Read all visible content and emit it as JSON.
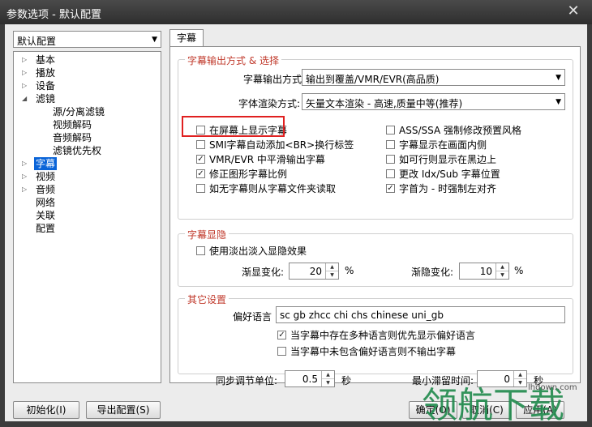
{
  "window": {
    "title": "参数选项 - 默认配置",
    "close": "✕"
  },
  "profile": {
    "value": "默认配置"
  },
  "tree": [
    {
      "label": "基本",
      "exp": "▷"
    },
    {
      "label": "播放",
      "exp": "▷"
    },
    {
      "label": "设备",
      "exp": "▷"
    },
    {
      "label": "滤镜",
      "exp": "◢"
    },
    {
      "label": "源/分离滤镜",
      "exp": ""
    },
    {
      "label": "视频解码",
      "exp": ""
    },
    {
      "label": "音频解码",
      "exp": ""
    },
    {
      "label": "滤镜优先权",
      "exp": ""
    },
    {
      "label": "字幕",
      "exp": "▷"
    },
    {
      "label": "视频",
      "exp": "▷"
    },
    {
      "label": "音频",
      "exp": "▷"
    },
    {
      "label": "网络",
      "exp": ""
    },
    {
      "label": "关联",
      "exp": ""
    },
    {
      "label": "配置",
      "exp": ""
    }
  ],
  "tab": "字幕",
  "output_group": {
    "title": "字幕输出方式 & 选择",
    "mode_label": "字幕输出方式：",
    "mode_value": "输出到覆盖/VMR/EVR(高品质)",
    "font_label": "字体渲染方式:",
    "font_value": "矢量文本渲染 - 高速,质量中等(推荐)",
    "options_left": [
      {
        "label": "在屏幕上显示字幕",
        "checked": false
      },
      {
        "label": "SMI字幕自动添加<BR>换行标签",
        "checked": false
      },
      {
        "label": "VMR/EVR 中平滑输出字幕",
        "checked": true
      },
      {
        "label": "修正图形字幕比例",
        "checked": true
      },
      {
        "label": "如无字幕则从字幕文件夹读取",
        "checked": false
      }
    ],
    "options_right": [
      {
        "label": "ASS/SSA 强制修改预置风格",
        "checked": false
      },
      {
        "label": "字幕显示在画面内侧",
        "checked": false
      },
      {
        "label": "如可行则显示在黑边上",
        "checked": false
      },
      {
        "label": "更改 Idx/Sub 字幕位置",
        "checked": false
      },
      {
        "label": "字首为 - 时强制左对齐",
        "checked": true
      }
    ]
  },
  "fade_group": {
    "title": "字幕显隐",
    "fade_checkbox": "使用淡出淡入显隐效果",
    "fade_in_label": "渐显变化:",
    "fade_in_value": "20",
    "fade_out_label": "渐隐变化:",
    "fade_out_value": "10",
    "unit": "%"
  },
  "other_group": {
    "title": "其它设置",
    "lang_label": "偏好语言",
    "lang_value": "sc gb zhcc chi chs chinese uni_gb",
    "opt1": "当字幕中存在多种语言则优先显示偏好语言",
    "opt2": "当字幕中未包含偏好语言则不输出字幕",
    "sync_label": "同步调节单位:",
    "sync_value": "0.5",
    "min_label": "最小滞留时间:",
    "min_value": "0",
    "sec": "秒"
  },
  "buttons": {
    "init": "初始化(I)",
    "export": "导出配置(S)",
    "ok": "确定(O)",
    "cancel": "取消(C)",
    "apply": "应用(A)"
  },
  "watermark": {
    "text": "领航下载",
    "url": "lhdown.com"
  }
}
